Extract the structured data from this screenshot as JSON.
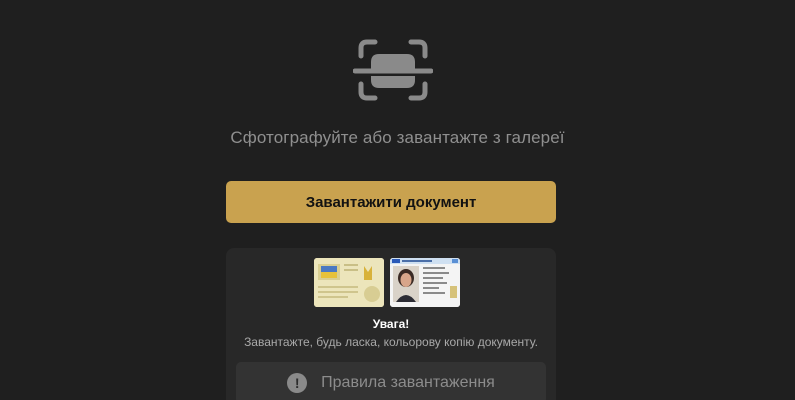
{
  "scan": {
    "icon": "scan-document-icon",
    "prompt": "Сфотографуйте або завантажте з галереї"
  },
  "upload": {
    "label": "Завантажити документ",
    "color": "#c9a24f"
  },
  "warning": {
    "title": "Увага!",
    "text": "Завантажте, будь ласка, кольорову копію документу."
  },
  "rules": {
    "icon": "exclamation-circle-icon",
    "label": "Правила завантаження"
  }
}
